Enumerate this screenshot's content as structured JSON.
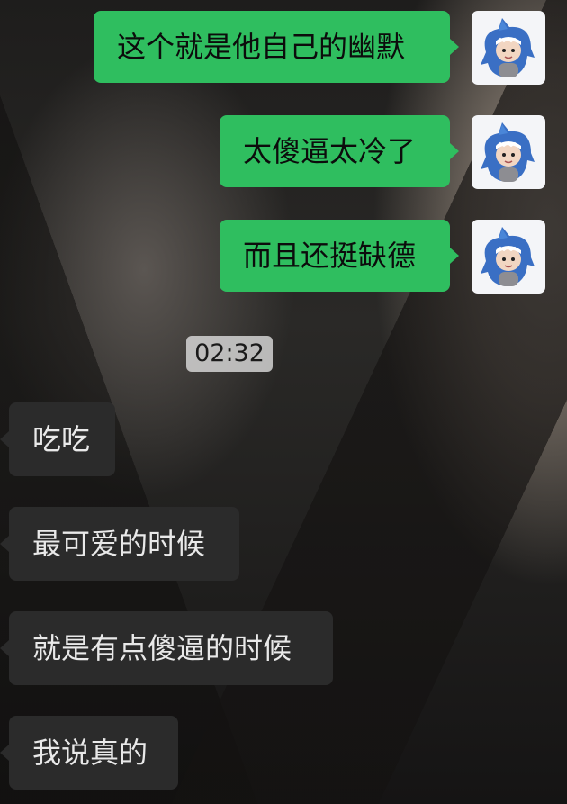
{
  "outgoing": [
    {
      "text": "这个就是他自己的幽默",
      "avatar_icon": "shark-hoodie-avatar-icon"
    },
    {
      "text": "太傻逼太冷了",
      "avatar_icon": "shark-hoodie-avatar-icon"
    },
    {
      "text": "而且还挺缺德",
      "avatar_icon": "shark-hoodie-avatar-icon"
    }
  ],
  "timestamp": "02:32",
  "incoming": [
    {
      "text": "吃吃"
    },
    {
      "text": "最可爱的时候"
    },
    {
      "text": "就是有点傻逼的时候"
    },
    {
      "text": "我说真的"
    }
  ],
  "colors": {
    "outgoing_bubble": "#2fbe5f",
    "incoming_bubble": "#2b2b2b",
    "timestamp_bg": "#e1e1e1"
  }
}
